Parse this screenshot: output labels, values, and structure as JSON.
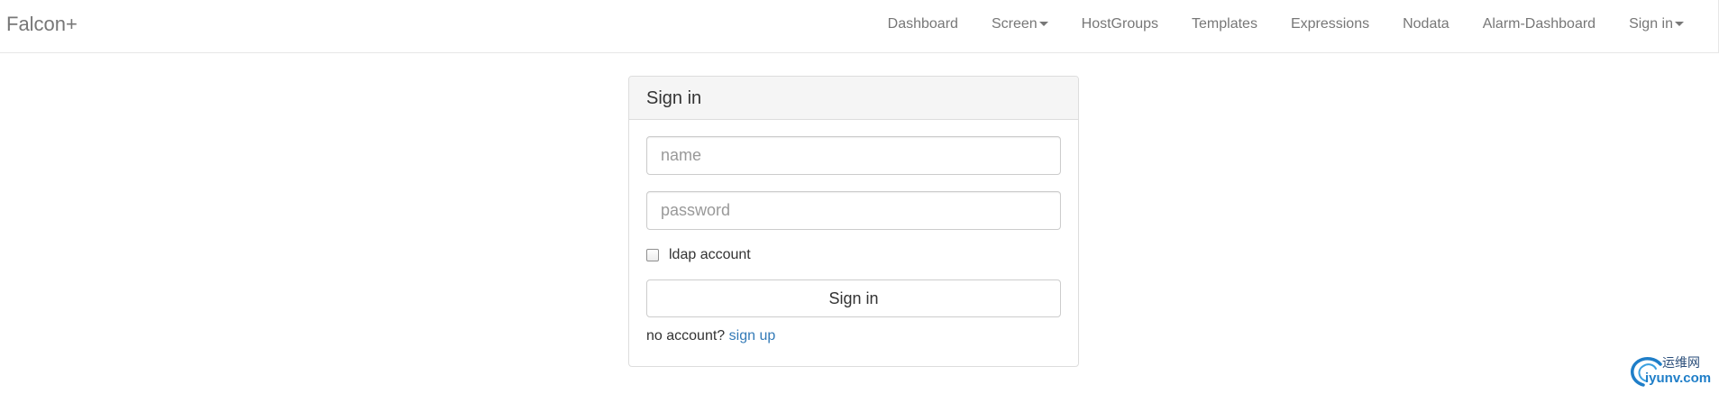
{
  "navbar": {
    "brand": "Falcon+",
    "items": [
      {
        "label": "Dashboard",
        "dropdown": false
      },
      {
        "label": "Screen",
        "dropdown": true
      },
      {
        "label": "HostGroups",
        "dropdown": false
      },
      {
        "label": "Templates",
        "dropdown": false
      },
      {
        "label": "Expressions",
        "dropdown": false
      },
      {
        "label": "Nodata",
        "dropdown": false
      },
      {
        "label": "Alarm-Dashboard",
        "dropdown": false
      },
      {
        "label": "Sign in",
        "dropdown": true
      }
    ]
  },
  "signin_panel": {
    "title": "Sign in",
    "name_field": {
      "placeholder": "name",
      "value": ""
    },
    "password_field": {
      "placeholder": "password",
      "value": ""
    },
    "ldap_checkbox": {
      "label": "ldap account",
      "checked": false
    },
    "submit_label": "Sign in",
    "signup_prompt": "no account?",
    "signup_link": "sign up"
  },
  "watermark": {
    "cn_text": "运维网",
    "en_text": "iyunv.com"
  },
  "colors": {
    "link": "#337ab7",
    "nav_text": "#777777",
    "panel_heading_bg": "#f5f5f5",
    "border": "#dddddd"
  }
}
